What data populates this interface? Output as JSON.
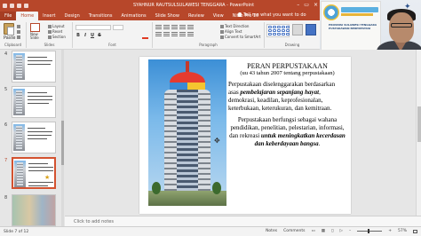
{
  "titlebar": {
    "title": "SYAHNUR RAUTSULSULAWESI TENGGARA - PowerPoint",
    "minimize": "–",
    "restore": "▭",
    "close": "×"
  },
  "tabs": [
    "File",
    "Home",
    "Insert",
    "Design",
    "Transitions",
    "Animations",
    "Slide Show",
    "Review",
    "View",
    "Nitro Pro 10"
  ],
  "tell_me": "Tell me what you want to do",
  "ribbon": {
    "clipboard": {
      "paste": "Paste",
      "label": "Clipboard"
    },
    "slides": {
      "new_slide": "New Slide",
      "layout": "Layout",
      "reset": "Reset",
      "section": "Section",
      "label": "Slides"
    },
    "font": {
      "label": "Font",
      "bold": "B",
      "italic": "I",
      "underline": "U",
      "strike": "S"
    },
    "paragraph": {
      "label": "Paragraph",
      "text_direction": "Text Direction",
      "align_text": "Align Text",
      "convert": "Convert to SmartArt"
    },
    "drawing": {
      "label": "Drawing"
    }
  },
  "webcam": {
    "poster_text": "PROVINSI SULAWESI TENGGARA PUSTAKAWAN BERPRESTASI"
  },
  "slides": [
    {
      "num": "4"
    },
    {
      "num": "5"
    },
    {
      "num": "6"
    },
    {
      "num": "7"
    },
    {
      "num": "8"
    }
  ],
  "slide": {
    "title": "PERAN PERPUSTAKAAN",
    "subtitle": "(uu 43 tahun 2007 tentang perpustakaan)",
    "p1": "Perpustakaan diselenggarakan berdasarkan asas ",
    "p1_em": "pembelajaran sepanjang hayat",
    "p1_rest": ", demokrasi, keadilan, keprofesionalan, keterbukaan, keterukuran, dan kemitraan.",
    "p2": "Perpustakaan berfungsi sebagai wahana pendidikan, penelitian, pelestarian, informasi, dan rekreasi ",
    "p2_em": "untuk meningkatkan kecerdasan dan keberdayaan bangsa",
    "p2_end": "."
  },
  "notes_placeholder": "Click to add notes",
  "status": {
    "slide_info": "Slide 7 of 12",
    "notes": "Notes",
    "comments": "Comments",
    "zoom": "57%"
  }
}
